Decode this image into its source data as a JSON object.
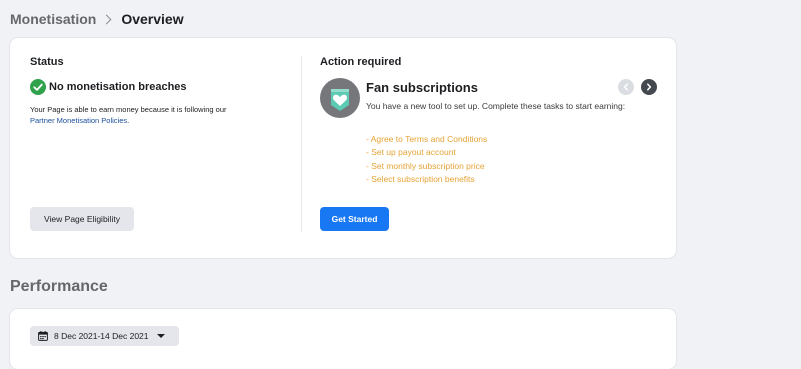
{
  "breadcrumb": {
    "parent": "Monetisation",
    "current": "Overview"
  },
  "status": {
    "title": "Status",
    "headline": "No monetisation breaches",
    "description": "Your Page is able to earn money because it is following our",
    "link_text": "Partner Monetisation Policies",
    "description_end": ".",
    "button_label": "View Page Eligibility"
  },
  "action": {
    "title": "Action required",
    "card_title": "Fan subscriptions",
    "card_description": "You have a new tool to set up. Complete these tasks to start earning:",
    "tasks": [
      "- Agree to Terms and Conditions",
      "- Set up payout account",
      "- Set monthly subscription price",
      "- Select subscription benefits"
    ],
    "button_label": "Get Started"
  },
  "performance": {
    "title": "Performance",
    "date_range": "8 Dec 2021-14 Dec 2021"
  },
  "colors": {
    "accent": "#1877f2",
    "success": "#31a24c",
    "task_text": "#e5a336"
  },
  "icons": {
    "breadcrumb_separator": "chevron-right-icon",
    "status_check": "check-circle-icon",
    "fan_subscriptions": "fan-badge-icon",
    "carousel_prev": "chevron-left-icon",
    "carousel_next": "chevron-right-icon",
    "date_picker": "calendar-icon",
    "date_dropdown": "caret-down-icon"
  }
}
